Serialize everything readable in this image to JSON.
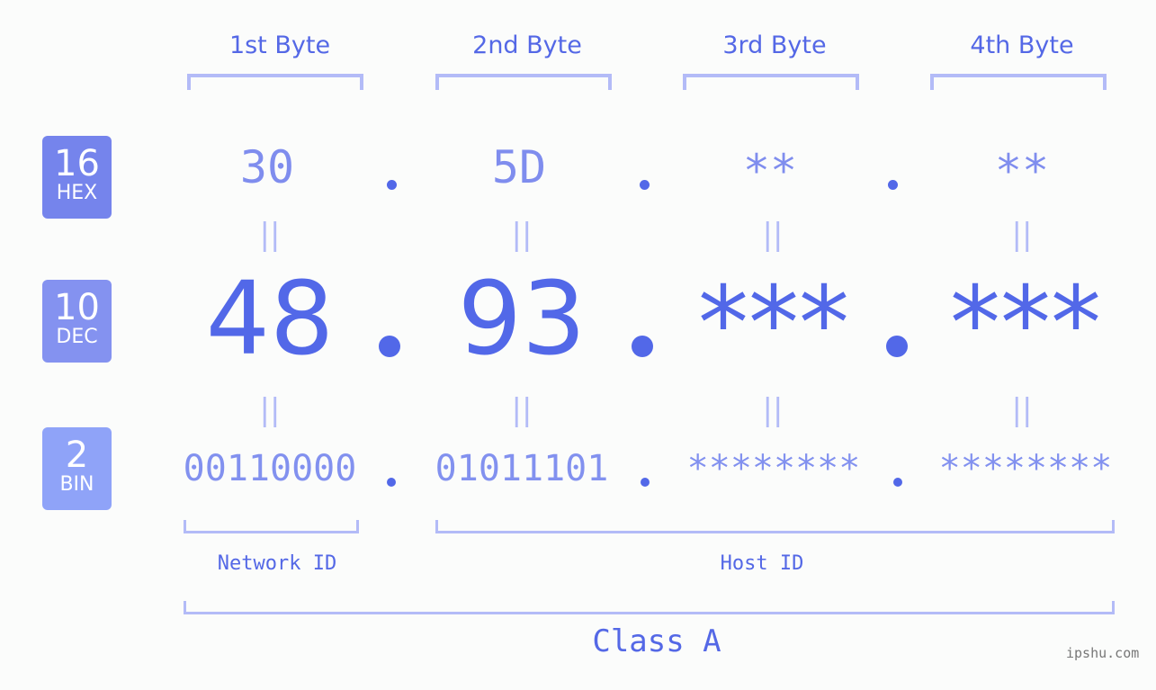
{
  "byte_headers": [
    "1st Byte",
    "2nd Byte",
    "3rd Byte",
    "4th Byte"
  ],
  "badges": {
    "hex": {
      "number": "16",
      "label": "HEX",
      "color": "#7584ec"
    },
    "dec": {
      "number": "10",
      "label": "DEC",
      "color": "#8492f0"
    },
    "bin": {
      "number": "2",
      "label": "BIN",
      "color": "#8fa3f8"
    }
  },
  "hex": [
    "30",
    "5D",
    "**",
    "**"
  ],
  "dec": [
    "48",
    "93",
    "***",
    "***"
  ],
  "bin": [
    "00110000",
    "01011101",
    "********",
    "********"
  ],
  "equals_symbol": "=",
  "segments": {
    "network": "Network ID",
    "host": "Host ID"
  },
  "class_label": "Class A",
  "watermark": "ipshu.com",
  "colors": {
    "accent": "#5268e8",
    "bracket": "#b3bbf7",
    "hex_text": "#7f8dee",
    "bin_text": "#8291ef"
  }
}
